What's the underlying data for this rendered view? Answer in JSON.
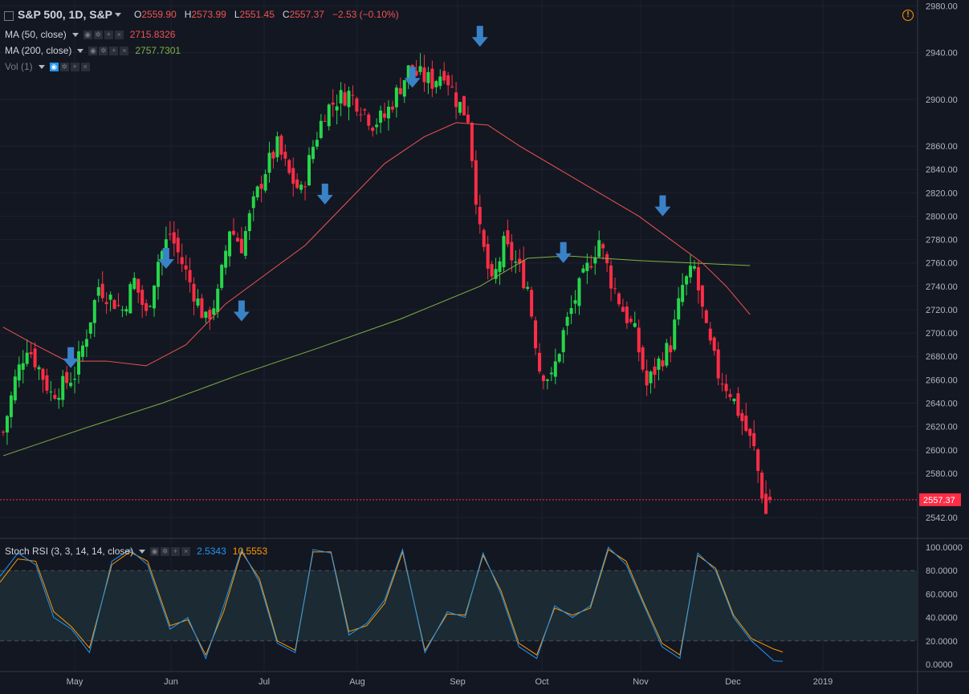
{
  "header": {
    "symbol": "S&P 500, 1D, S&P",
    "open_label": "O",
    "open": "2559.90",
    "high_label": "H",
    "high": "2573.99",
    "low_label": "L",
    "low": "2551.45",
    "close_label": "C",
    "close": "2557.37",
    "change": "−2.53 (−0.10%)"
  },
  "indicators": {
    "ma50": {
      "label": "MA (50, close)",
      "value": "2715.8326",
      "color": "#ef5350"
    },
    "ma200": {
      "label": "MA (200, close)",
      "value": "2757.7301",
      "color": "#7cb342"
    },
    "vol": {
      "label": "Vol (1)"
    },
    "stoch": {
      "label": "Stoch RSI (3, 3, 14, 14, close)",
      "k_value": "2.5343",
      "d_value": "10.5553",
      "k_color": "#2196f3",
      "d_color": "#ff9800"
    }
  },
  "icons": [
    "chart-warning-icon",
    "eye-icon",
    "gear-icon",
    "plus-icon",
    "close-icon"
  ],
  "price_tag": "2557.37",
  "colors": {
    "up": "#26d64a",
    "down": "#ff2d45",
    "background": "#131722",
    "grid": "#1e2230"
  },
  "chart_data": {
    "type": "candlestick",
    "x_labels": [
      "May",
      "Jun",
      "Jul",
      "Aug",
      "Sep",
      "Oct",
      "Nov",
      "Dec",
      "2019"
    ],
    "y_ticks": [
      "2542.00",
      "2580.00",
      "2600.00",
      "2620.00",
      "2640.00",
      "2660.00",
      "2680.00",
      "2700.00",
      "2720.00",
      "2740.00",
      "2760.00",
      "2780.00",
      "2800.00",
      "2820.00",
      "2840.00",
      "2860.00",
      "2900.00",
      "2940.00",
      "2980.00"
    ],
    "ylim": [
      2525,
      2985
    ],
    "close_path": [
      [
        0,
        2615
      ],
      [
        3,
        2660
      ],
      [
        6,
        2690
      ],
      [
        9,
        2670
      ],
      [
        12,
        2648
      ],
      [
        15,
        2655
      ],
      [
        18,
        2665
      ],
      [
        21,
        2700
      ],
      [
        24,
        2740
      ],
      [
        27,
        2730
      ],
      [
        30,
        2720
      ],
      [
        33,
        2745
      ],
      [
        36,
        2715
      ],
      [
        39,
        2762
      ],
      [
        42,
        2785
      ],
      [
        45,
        2760
      ],
      [
        48,
        2735
      ],
      [
        51,
        2710
      ],
      [
        54,
        2732
      ],
      [
        57,
        2790
      ],
      [
        60,
        2775
      ],
      [
        63,
        2810
      ],
      [
        66,
        2840
      ],
      [
        69,
        2860
      ],
      [
        72,
        2835
      ],
      [
        75,
        2820
      ],
      [
        78,
        2860
      ],
      [
        81,
        2890
      ],
      [
        84,
        2900
      ],
      [
        87,
        2905
      ],
      [
        90,
        2895
      ],
      [
        93,
        2880
      ],
      [
        96,
        2885
      ],
      [
        99,
        2905
      ],
      [
        102,
        2925
      ],
      [
        105,
        2920
      ],
      [
        108,
        2915
      ],
      [
        111,
        2925
      ],
      [
        114,
        2900
      ],
      [
        117,
        2885
      ],
      [
        120,
        2785
      ],
      [
        123,
        2740
      ],
      [
        126,
        2775
      ],
      [
        129,
        2760
      ],
      [
        132,
        2740
      ],
      [
        135,
        2670
      ],
      [
        138,
        2660
      ],
      [
        141,
        2700
      ],
      [
        144,
        2730
      ],
      [
        147,
        2755
      ],
      [
        150,
        2780
      ],
      [
        153,
        2745
      ],
      [
        156,
        2720
      ],
      [
        159,
        2700
      ],
      [
        162,
        2655
      ],
      [
        165,
        2675
      ],
      [
        168,
        2690
      ],
      [
        171,
        2740
      ],
      [
        174,
        2755
      ],
      [
        177,
        2700
      ],
      [
        180,
        2665
      ],
      [
        183,
        2650
      ],
      [
        186,
        2625
      ],
      [
        189,
        2600
      ],
      [
        192,
        2545
      ],
      [
        193,
        2557.37
      ]
    ],
    "ma50": [
      [
        0,
        2705
      ],
      [
        8,
        2690
      ],
      [
        16,
        2676
      ],
      [
        26,
        2676
      ],
      [
        36,
        2672
      ],
      [
        46,
        2690
      ],
      [
        56,
        2725
      ],
      [
        66,
        2750
      ],
      [
        76,
        2775
      ],
      [
        86,
        2810
      ],
      [
        96,
        2845
      ],
      [
        106,
        2868
      ],
      [
        114,
        2880
      ],
      [
        122,
        2878
      ],
      [
        130,
        2860
      ],
      [
        140,
        2840
      ],
      [
        150,
        2820
      ],
      [
        160,
        2800
      ],
      [
        168,
        2780
      ],
      [
        176,
        2760
      ],
      [
        182,
        2740
      ],
      [
        188,
        2715.8326
      ]
    ],
    "ma200": [
      [
        0,
        2595
      ],
      [
        20,
        2618
      ],
      [
        40,
        2640
      ],
      [
        60,
        2665
      ],
      [
        80,
        2688
      ],
      [
        100,
        2712
      ],
      [
        120,
        2740
      ],
      [
        132,
        2764
      ],
      [
        142,
        2766
      ],
      [
        160,
        2762
      ],
      [
        188,
        2757.7301
      ]
    ],
    "markers": [
      [
        17,
        2670
      ],
      [
        41,
        2755
      ],
      [
        60,
        2710
      ],
      [
        81,
        2810
      ],
      [
        103,
        2910
      ],
      [
        120,
        2945
      ],
      [
        141,
        2760
      ],
      [
        166,
        2800
      ]
    ],
    "last_price": 2557.37,
    "stoch_rsi": {
      "y_ticks": [
        "100.0000",
        "80.0000",
        "60.0000",
        "40.0000",
        "20.0000",
        "0.0000"
      ],
      "ylim": [
        0,
        100
      ],
      "bands": [
        20,
        80
      ],
      "k": [
        [
          0,
          75
        ],
        [
          4,
          95
        ],
        [
          8,
          85
        ],
        [
          12,
          40
        ],
        [
          16,
          30
        ],
        [
          20,
          10
        ],
        [
          25,
          88
        ],
        [
          29,
          98
        ],
        [
          33,
          85
        ],
        [
          38,
          30
        ],
        [
          42,
          40
        ],
        [
          46,
          5
        ],
        [
          50,
          50
        ],
        [
          54,
          98
        ],
        [
          58,
          70
        ],
        [
          62,
          18
        ],
        [
          66,
          10
        ],
        [
          70,
          98
        ],
        [
          74,
          95
        ],
        [
          78,
          25
        ],
        [
          82,
          35
        ],
        [
          86,
          55
        ],
        [
          90,
          98
        ],
        [
          95,
          10
        ],
        [
          100,
          45
        ],
        [
          104,
          40
        ],
        [
          108,
          95
        ],
        [
          112,
          60
        ],
        [
          116,
          15
        ],
        [
          120,
          5
        ],
        [
          124,
          50
        ],
        [
          128,
          40
        ],
        [
          132,
          50
        ],
        [
          136,
          100
        ],
        [
          140,
          85
        ],
        [
          144,
          50
        ],
        [
          148,
          15
        ],
        [
          152,
          5
        ],
        [
          156,
          95
        ],
        [
          160,
          80
        ],
        [
          164,
          40
        ],
        [
          168,
          20
        ],
        [
          173,
          3
        ],
        [
          175,
          2.5343
        ]
      ],
      "d": [
        [
          0,
          70
        ],
        [
          4,
          90
        ],
        [
          8,
          88
        ],
        [
          12,
          45
        ],
        [
          16,
          32
        ],
        [
          20,
          14
        ],
        [
          25,
          85
        ],
        [
          29,
          96
        ],
        [
          33,
          88
        ],
        [
          38,
          33
        ],
        [
          42,
          38
        ],
        [
          46,
          8
        ],
        [
          50,
          45
        ],
        [
          54,
          96
        ],
        [
          58,
          73
        ],
        [
          62,
          20
        ],
        [
          66,
          12
        ],
        [
          70,
          96
        ],
        [
          74,
          96
        ],
        [
          78,
          28
        ],
        [
          82,
          33
        ],
        [
          86,
          52
        ],
        [
          90,
          96
        ],
        [
          95,
          12
        ],
        [
          100,
          43
        ],
        [
          104,
          42
        ],
        [
          108,
          93
        ],
        [
          112,
          63
        ],
        [
          116,
          18
        ],
        [
          120,
          8
        ],
        [
          124,
          48
        ],
        [
          128,
          42
        ],
        [
          132,
          48
        ],
        [
          136,
          98
        ],
        [
          140,
          88
        ],
        [
          144,
          52
        ],
        [
          148,
          18
        ],
        [
          152,
          8
        ],
        [
          156,
          93
        ],
        [
          160,
          82
        ],
        [
          164,
          42
        ],
        [
          168,
          22
        ],
        [
          173,
          13
        ],
        [
          175,
          10.5553
        ]
      ]
    }
  }
}
